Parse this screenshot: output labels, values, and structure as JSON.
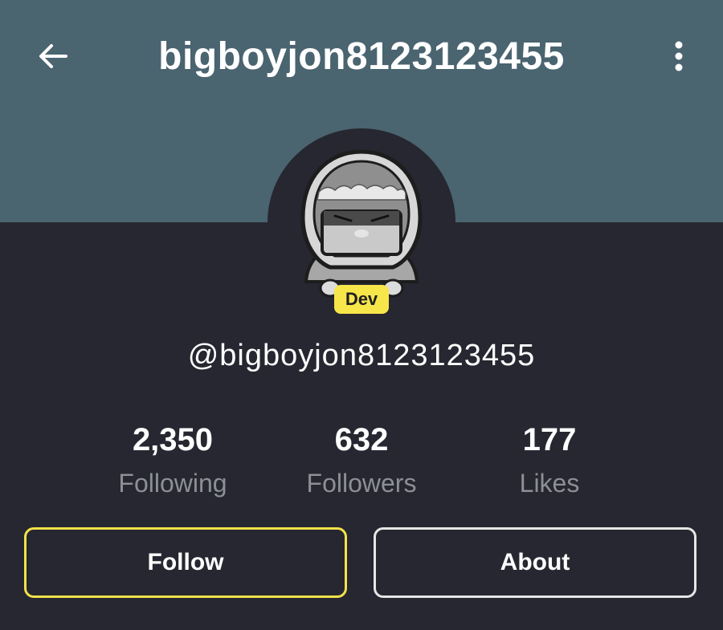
{
  "header": {
    "title": "bigboyjon8123123455",
    "back_icon": "arrow-left-icon",
    "menu_icon": "more-vertical-icon"
  },
  "profile": {
    "handle": "@bigboyjon8123123455",
    "badge": "Dev"
  },
  "stats": [
    {
      "value": "2,350",
      "label": "Following"
    },
    {
      "value": "632",
      "label": "Followers"
    },
    {
      "value": "177",
      "label": "Likes"
    }
  ],
  "actions": {
    "follow_label": "Follow",
    "about_label": "About"
  },
  "colors": {
    "banner": "#4a6470",
    "background": "#262730",
    "badge": "#f7e64a",
    "follow_border": "#f2e24a",
    "about_border": "#e6e6e6",
    "muted_text": "#8d8f96"
  }
}
